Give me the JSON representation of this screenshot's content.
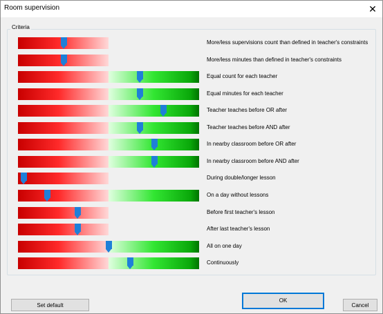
{
  "window": {
    "title": "Room supervision",
    "close_glyph": "✕"
  },
  "group": {
    "label": "Criteria"
  },
  "criteria": [
    {
      "label": "More/less supervisions count than defined in teacher's constraints",
      "green": false,
      "value": 0.25
    },
    {
      "label": "More/less minutes than defined in teacher's constraints",
      "green": false,
      "value": 0.25
    },
    {
      "label": "Equal count for each teacher",
      "green": true,
      "value": 0.67
    },
    {
      "label": "Equal minutes for each teacher",
      "green": true,
      "value": 0.67
    },
    {
      "label": "Teacher teaches before OR after",
      "green": true,
      "value": 0.8
    },
    {
      "label": "Teacher teaches before AND after",
      "green": true,
      "value": 0.67
    },
    {
      "label": "In nearby classroom before OR after",
      "green": true,
      "value": 0.75
    },
    {
      "label": "In nearby classroom before AND after",
      "green": true,
      "value": 0.75
    },
    {
      "label": "During double/longer lesson",
      "green": false,
      "value": 0.03
    },
    {
      "label": "On a day without lessons",
      "green": true,
      "value": 0.16
    },
    {
      "label": "Before first teacher's lesson",
      "green": false,
      "value": 0.33
    },
    {
      "label": "After last teacher's lesson",
      "green": false,
      "value": 0.33
    },
    {
      "label": "All on one day",
      "green": true,
      "value": 0.5
    },
    {
      "label": "Continuously",
      "green": true,
      "value": 0.62
    }
  ],
  "buttons": {
    "set_default": "Set default",
    "ok": "OK",
    "cancel": "Cancel"
  },
  "colors": {
    "thumb": "#1f7fd8",
    "red": "#c80000",
    "green": "#007400",
    "default_border": "#0078d7"
  }
}
